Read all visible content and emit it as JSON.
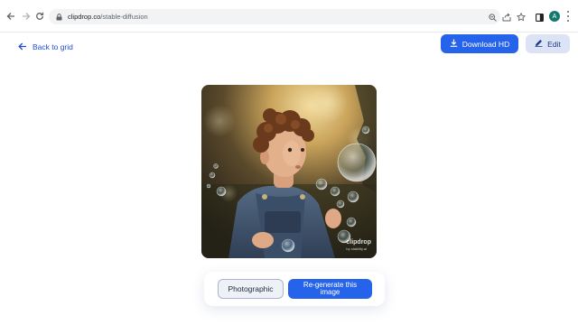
{
  "browser": {
    "url_domain": "clipdrop.co",
    "url_path": "/stable-diffusion",
    "avatar_letter": "A",
    "avatar_color": "#16796e"
  },
  "page": {
    "back_label": "Back to grid",
    "download_label": "Download HD",
    "edit_label": "Edit",
    "style_label": "Photographic",
    "regenerate_label": "Re-generate this image",
    "watermark_brand": "clipdrop",
    "watermark_sub": "by stability.ai"
  },
  "colors": {
    "primary": "#2563eb",
    "secondary": "#dbe3f4",
    "link": "#1d4ed8"
  },
  "icons": [
    "back-arrow-icon",
    "forward-arrow-icon",
    "reload-icon",
    "lock-icon",
    "zoom-icon",
    "share-icon",
    "bookmark-star-icon",
    "side-panel-icon",
    "menu-dots-icon",
    "arrow-left-icon",
    "download-icon",
    "pencil-icon"
  ]
}
